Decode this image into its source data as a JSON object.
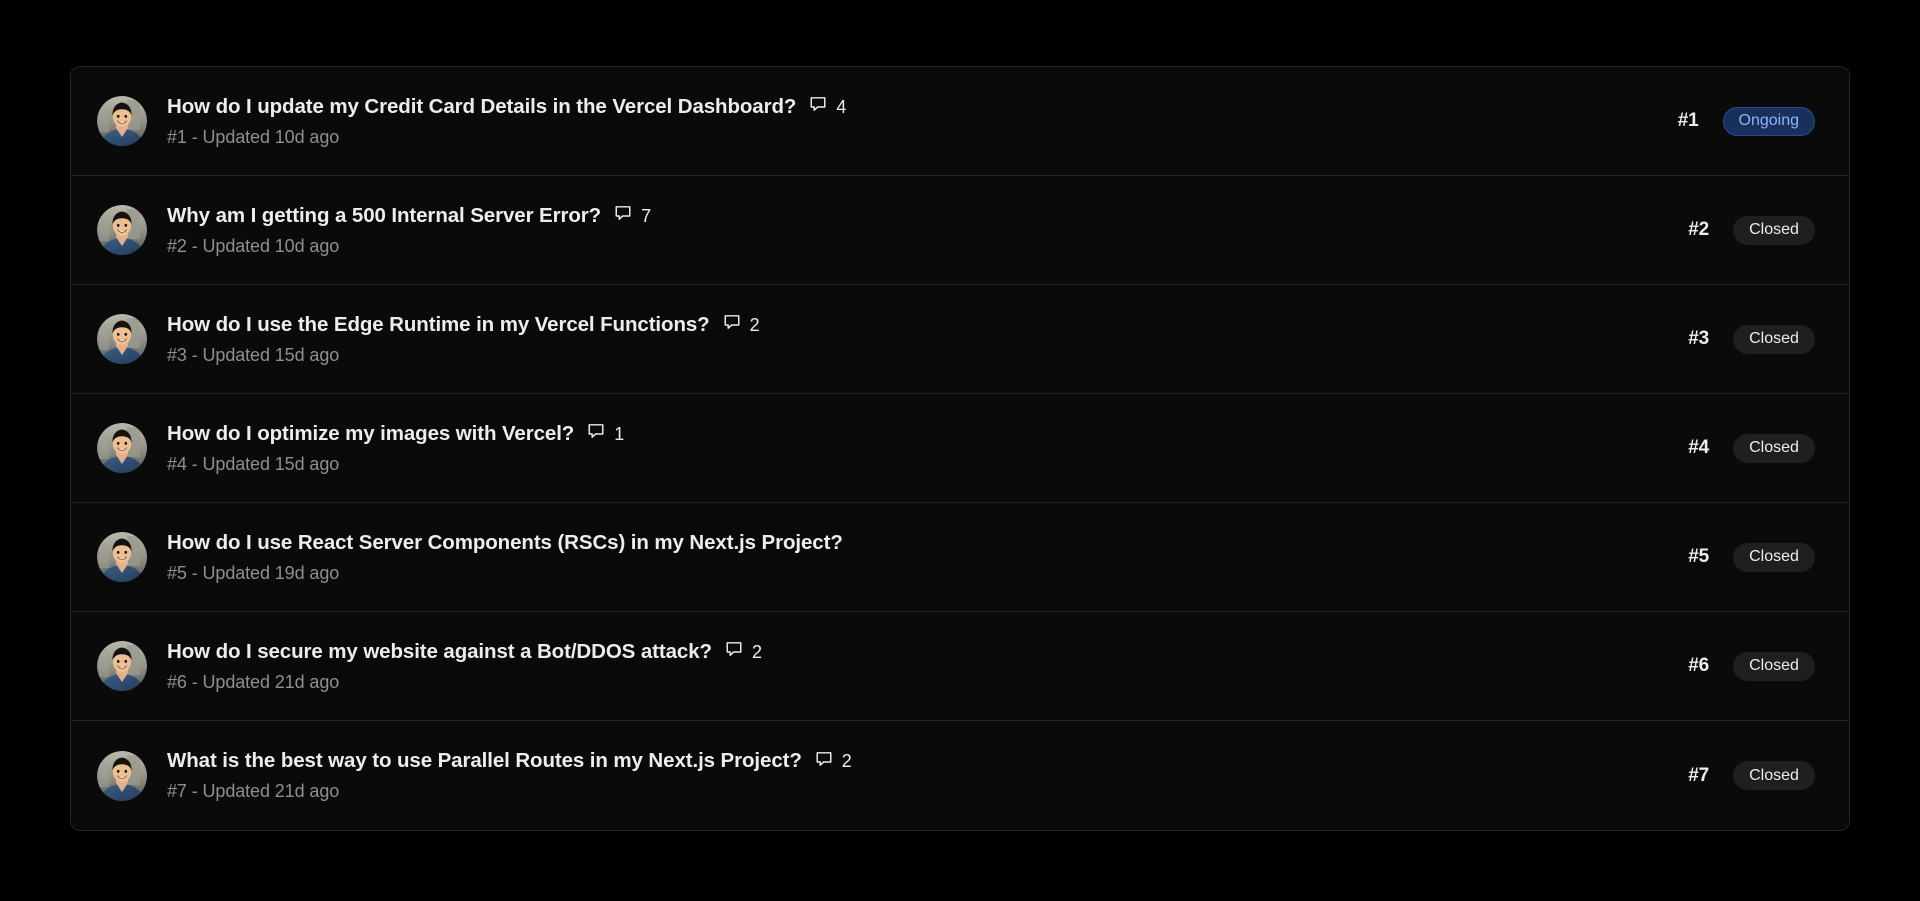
{
  "theme": {
    "page_background": "#000000",
    "card_background": "#0a0a0a",
    "card_border": "#232323",
    "divider": "#222222",
    "title_color": "#ededed",
    "subtitle_color": "#8f8f8f",
    "badge_ongoing_bg": "#19305c",
    "badge_ongoing_text": "#8cb4f8",
    "badge_closed_bg": "#1f1f1f",
    "badge_closed_text": "#ededed"
  },
  "icons": {
    "comment": "comment-bubble-icon",
    "avatar": "user-avatar-image"
  },
  "tickets": [
    {
      "title": "How do I update my Credit Card Details in the Vercel Dashboard?",
      "comment_count": "4",
      "has_comments": true,
      "subtitle": "#1 - Updated 10d ago",
      "number": "#1",
      "status": "Ongoing",
      "status_kind": "ongoing"
    },
    {
      "title": "Why am I getting a 500 Internal Server Error?",
      "comment_count": "7",
      "has_comments": true,
      "subtitle": "#2 - Updated 10d ago",
      "number": "#2",
      "status": "Closed",
      "status_kind": "closed"
    },
    {
      "title": "How do I use the Edge Runtime in my Vercel Functions?",
      "comment_count": "2",
      "has_comments": true,
      "subtitle": "#3 - Updated 15d ago",
      "number": "#3",
      "status": "Closed",
      "status_kind": "closed"
    },
    {
      "title": "How do I optimize my images with Vercel?",
      "comment_count": "1",
      "has_comments": true,
      "subtitle": "#4 - Updated 15d ago",
      "number": "#4",
      "status": "Closed",
      "status_kind": "closed"
    },
    {
      "title": "How do I use React Server Components (RSCs) in my Next.js Project?",
      "comment_count": "",
      "has_comments": false,
      "subtitle": "#5 - Updated 19d ago",
      "number": "#5",
      "status": "Closed",
      "status_kind": "closed"
    },
    {
      "title": "How do I secure my website against a Bot/DDOS attack?",
      "comment_count": "2",
      "has_comments": true,
      "subtitle": "#6 - Updated 21d ago",
      "number": "#6",
      "status": "Closed",
      "status_kind": "closed"
    },
    {
      "title": "What is the best way to use Parallel Routes in my Next.js Project?",
      "comment_count": "2",
      "has_comments": true,
      "subtitle": "#7 - Updated 21d ago",
      "number": "#7",
      "status": "Closed",
      "status_kind": "closed"
    }
  ]
}
